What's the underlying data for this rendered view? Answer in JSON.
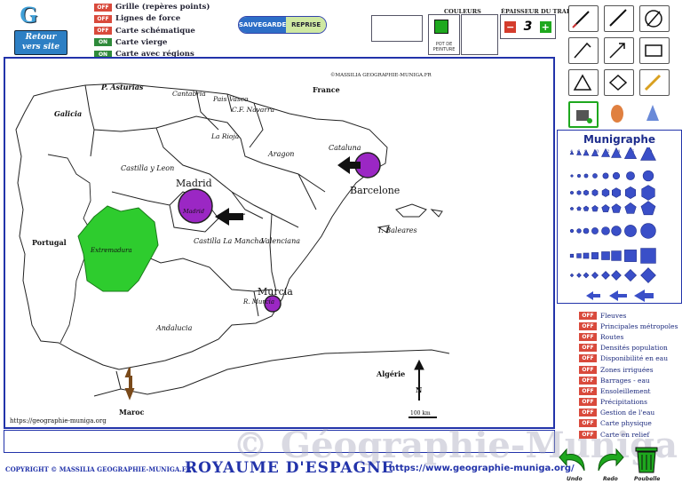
{
  "logo": {
    "letter": "G",
    "retour_label": "Retour",
    "vers_site_label": "vers site"
  },
  "toggles": [
    {
      "state": "OFF",
      "label": "Grille (repères points)"
    },
    {
      "state": "OFF",
      "label": "Lignes de force"
    },
    {
      "state": "OFF",
      "label": "Carte schématique"
    },
    {
      "state": "ON",
      "label": "Carte vierge"
    },
    {
      "state": "ON",
      "label": "Carte avec régions"
    }
  ],
  "save": {
    "sauvegarde": "SAUVEGARDE",
    "reprise": "REPRISE"
  },
  "colors": {
    "label": "COULEURS",
    "pot_label": "POT DE PEINTURE",
    "selected_color": "#1ea81e"
  },
  "thickness": {
    "label": "ÉPAISSEUR DU TRAIT",
    "value": "3",
    "minus": "−",
    "plus": "+"
  },
  "map": {
    "credit": "©MASSILIA GEOGRAPHIE-MUNIGA.FR",
    "source": "https://geographie-muniga.org",
    "scale": "100 km",
    "north": "N",
    "regions": [
      "P. Asturias",
      "Cantabria",
      "Pais Vasco",
      "C.F. Navarra",
      "Galicia",
      "La Rioja",
      "Aragon",
      "Cataluna",
      "Castilla y Leon",
      "Madrid",
      "Extremadura",
      "Castilla La Mancha",
      "Valenciana",
      "I. Baleares",
      "R. Murcia",
      "Andalucia"
    ],
    "countries": [
      "France",
      "Portugal",
      "Algérie",
      "Maroc"
    ],
    "cities": [
      "Madrid",
      "Barcelone",
      "Murcia"
    ]
  },
  "munigraphe": {
    "title": "Munigraphe",
    "sizes": [
      "4",
      "6",
      "8",
      "10",
      "12",
      "14",
      "16",
      "20"
    ]
  },
  "layers": [
    {
      "state": "OFF",
      "label": "Fleuves"
    },
    {
      "state": "OFF",
      "label": "Principales métropoles"
    },
    {
      "state": "OFF",
      "label": "Routes"
    },
    {
      "state": "OFF",
      "label": "Densités population"
    },
    {
      "state": "OFF",
      "label": "Disponibilité en eau"
    },
    {
      "state": "OFF",
      "label": "Zones irriguées"
    },
    {
      "state": "OFF",
      "label": "Barrages - eau"
    },
    {
      "state": "OFF",
      "label": "Ensoleillement"
    },
    {
      "state": "OFF",
      "label": "Précipitations"
    },
    {
      "state": "OFF",
      "label": "Gestion de l'eau"
    },
    {
      "state": "OFF",
      "label": "Carte physique"
    },
    {
      "state": "OFF",
      "label": "Carte en relief"
    }
  ],
  "footer": {
    "copyright": "COPYRIGHT © MASSILIA GEOGRAPHIE-MUNIGA.FR",
    "title": "ROYAUME D'ESPAGNE",
    "url": "https://www.geographie-muniga.org/",
    "watermark": "© Géographie-Muniga"
  },
  "actions": {
    "undo": "Undo",
    "redo": "Redo",
    "trash": "Poubelle"
  }
}
